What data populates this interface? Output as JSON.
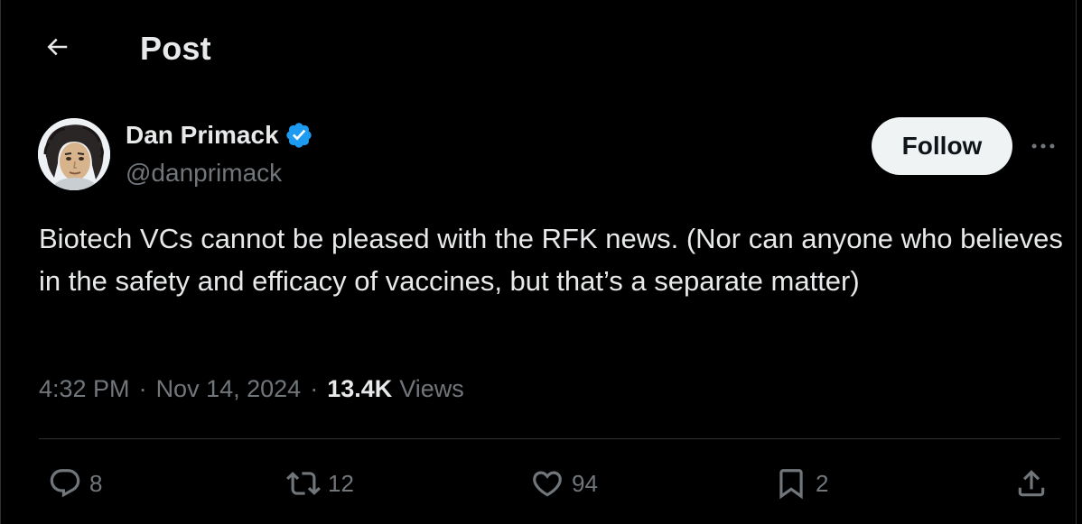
{
  "header": {
    "title": "Post",
    "back_icon": "arrow-left-icon"
  },
  "author": {
    "name": "Dan Primack",
    "handle": "@danprimack",
    "verified_badge": "verified-badge-icon",
    "verified_color": "#1d9bf0"
  },
  "follow_button": {
    "label": "Follow"
  },
  "more_icon": "more-horizontal-icon",
  "tweet": {
    "text": "Biotech VCs cannot be pleased with the RFK news. (Nor can anyone who believes in the safety and efficacy of vaccines, but that’s a separate matter)",
    "time": "4:32 PM",
    "date": "Nov 14, 2024",
    "separator": "·",
    "views_count": "13.4K",
    "views_label": "Views"
  },
  "actions": {
    "replies": "8",
    "reposts": "12",
    "likes": "94",
    "bookmarks": "2"
  },
  "colors": {
    "background": "#000000",
    "text_primary": "#e7e9ea",
    "text_secondary": "#71767b",
    "divider": "#2f3336",
    "follow_bg": "#eff3f4"
  }
}
